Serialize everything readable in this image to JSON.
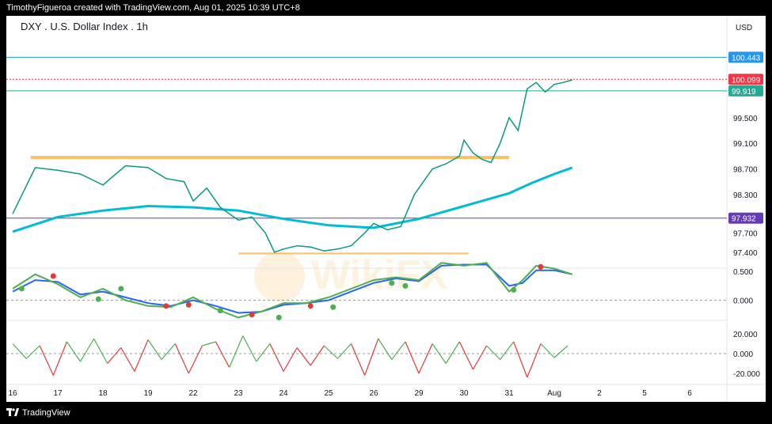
{
  "header": {
    "credit": "TimothyFigueroa created with TradingView.com, Aug 01, 2025 10:39 UTC+8"
  },
  "footer": {
    "brand": "TradingView"
  },
  "chart_data": {
    "type": "line",
    "title": "DXY . U.S. Dollar Index . 1h",
    "currency": "USD",
    "watermark": "WikiFX",
    "x_labels": [
      "16",
      "17",
      "18",
      "19",
      "22",
      "23",
      "24",
      "25",
      "26",
      "29",
      "30",
      "31",
      "Aug",
      "2",
      "5",
      "6"
    ],
    "price_panel": {
      "ylim": [
        97.2,
        100.72
      ],
      "y_ticks": [
        "99.500",
        "99.100",
        "98.700",
        "98.300",
        "97.700",
        "97.400"
      ],
      "price_series": {
        "name": "DXY",
        "x": [
          0,
          0.5,
          1,
          1.5,
          2,
          2.5,
          3,
          3.4,
          3.8,
          4,
          4.3,
          4.6,
          4.9,
          5,
          5.3,
          5.6,
          5.8,
          6,
          6.3,
          6.6,
          6.9,
          7.2,
          7.5,
          7.8,
          8,
          8.3,
          8.6,
          8.9,
          9,
          9.3,
          9.6,
          9.9,
          10,
          10.2,
          10.4,
          10.6,
          10.8,
          11,
          11.2,
          11.4,
          11.6,
          11.8,
          12,
          12.2,
          12.4
        ],
        "y": [
          98.0,
          98.72,
          98.68,
          98.62,
          98.45,
          98.75,
          98.72,
          98.55,
          98.5,
          98.2,
          98.4,
          98.1,
          97.95,
          97.9,
          97.95,
          97.7,
          97.4,
          97.45,
          97.5,
          97.48,
          97.42,
          97.45,
          97.5,
          97.7,
          97.85,
          97.75,
          97.8,
          98.3,
          98.4,
          98.7,
          98.78,
          98.9,
          99.15,
          98.95,
          98.85,
          98.8,
          99.1,
          99.5,
          99.3,
          99.95,
          100.05,
          99.9,
          100.02,
          100.05,
          100.09
        ]
      },
      "moving_average": {
        "color": "#00bcd4",
        "x": [
          0,
          1,
          2,
          3,
          4,
          5,
          6,
          7,
          8,
          9,
          10,
          11,
          11.5,
          12,
          12.4
        ],
        "y": [
          97.72,
          97.95,
          98.05,
          98.12,
          98.1,
          98.05,
          97.92,
          97.82,
          97.78,
          97.92,
          98.12,
          98.32,
          98.48,
          98.62,
          98.72
        ]
      },
      "horizontal_lines": [
        {
          "value": 100.443,
          "label": "100.443",
          "color": "#2196f3"
        },
        {
          "value": 100.099,
          "label": "100.099",
          "color": "#f23645"
        },
        {
          "value": 99.919,
          "label": "99.919",
          "color": "#22ab94"
        },
        {
          "value": 97.932,
          "label": "97.932",
          "color": "#673ab7"
        }
      ],
      "zones": [
        {
          "from_x": 0.4,
          "to_x": 11.0,
          "value": 98.88,
          "color": "#ffb74d"
        },
        {
          "from_x": 5.0,
          "to_x": 10.1,
          "value": 97.38,
          "color": "#ffb74d"
        }
      ]
    },
    "oscillator_panel": {
      "ylim": [
        -0.35,
        0.75
      ],
      "y_ticks": [
        "0.500",
        "0.000"
      ],
      "fast": {
        "color": "#4caf50",
        "x": [
          0,
          0.5,
          1,
          1.5,
          2,
          2.5,
          3,
          3.5,
          4,
          4.5,
          5,
          5.5,
          6,
          6.5,
          7,
          7.5,
          8,
          8.5,
          9,
          9.5,
          10,
          10.5,
          11,
          11.3,
          11.6,
          12,
          12.4
        ],
        "y": [
          0.2,
          0.45,
          0.28,
          0.05,
          0.2,
          0.0,
          -0.1,
          -0.12,
          0.05,
          -0.15,
          -0.3,
          -0.2,
          -0.05,
          -0.05,
          0.05,
          0.2,
          0.35,
          0.4,
          0.35,
          0.65,
          0.6,
          0.65,
          0.15,
          0.35,
          0.6,
          0.55,
          0.45
        ]
      },
      "slow": {
        "color": "#2962ff",
        "x": [
          0,
          0.5,
          1,
          1.5,
          2,
          2.5,
          3,
          3.5,
          4,
          4.5,
          5,
          5.5,
          6,
          6.5,
          7,
          7.5,
          8,
          8.5,
          9,
          9.5,
          10,
          10.5,
          11,
          11.3,
          11.6,
          12,
          12.4
        ],
        "y": [
          0.15,
          0.35,
          0.32,
          0.1,
          0.15,
          0.05,
          -0.05,
          -0.1,
          0.0,
          -0.1,
          -0.22,
          -0.2,
          -0.08,
          -0.05,
          0.0,
          0.15,
          0.3,
          0.38,
          0.33,
          0.6,
          0.62,
          0.62,
          0.25,
          0.3,
          0.52,
          0.52,
          0.45
        ]
      },
      "cross_markers": [
        {
          "x": 0.2,
          "y": 0.2,
          "color": "#4caf50"
        },
        {
          "x": 0.9,
          "y": 0.42,
          "color": "#e53935"
        },
        {
          "x": 1.9,
          "y": 0.02,
          "color": "#4caf50"
        },
        {
          "x": 2.4,
          "y": 0.2,
          "color": "#4caf50"
        },
        {
          "x": 3.4,
          "y": -0.1,
          "color": "#e53935"
        },
        {
          "x": 3.9,
          "y": -0.08,
          "color": "#e53935"
        },
        {
          "x": 4.6,
          "y": -0.18,
          "color": "#4caf50"
        },
        {
          "x": 5.3,
          "y": -0.25,
          "color": "#e53935"
        },
        {
          "x": 5.9,
          "y": -0.3,
          "color": "#4caf50"
        },
        {
          "x": 6.6,
          "y": -0.1,
          "color": "#e53935"
        },
        {
          "x": 7.1,
          "y": -0.12,
          "color": "#4caf50"
        },
        {
          "x": 8.4,
          "y": 0.3,
          "color": "#4caf50"
        },
        {
          "x": 8.7,
          "y": 0.25,
          "color": "#4caf50"
        },
        {
          "x": 11.1,
          "y": 0.18,
          "color": "#4caf50"
        },
        {
          "x": 11.7,
          "y": 0.58,
          "color": "#e53935"
        }
      ]
    },
    "rsi_panel": {
      "ylim": [
        -28,
        28
      ],
      "y_ticks": [
        "20.000",
        "0.000",
        "-20.000"
      ],
      "series": {
        "x": [
          0,
          0.3,
          0.6,
          0.9,
          1.2,
          1.5,
          1.8,
          2.1,
          2.4,
          2.7,
          3.0,
          3.3,
          3.6,
          3.9,
          4.2,
          4.5,
          4.8,
          5.1,
          5.4,
          5.7,
          6.0,
          6.3,
          6.6,
          6.9,
          7.2,
          7.5,
          7.8,
          8.1,
          8.4,
          8.7,
          9.0,
          9.3,
          9.6,
          9.9,
          10.2,
          10.5,
          10.8,
          11.1,
          11.4,
          11.7,
          12.0,
          12.3
        ],
        "y": [
          10,
          -5,
          8,
          -22,
          12,
          -8,
          15,
          -10,
          6,
          -18,
          14,
          -6,
          10,
          -20,
          8,
          12,
          -14,
          18,
          -8,
          10,
          -18,
          6,
          -12,
          8,
          -5,
          10,
          -22,
          15,
          -6,
          12,
          -20,
          10,
          -10,
          12,
          -16,
          8,
          -6,
          12,
          -24,
          10,
          -4,
          8
        ]
      }
    }
  }
}
